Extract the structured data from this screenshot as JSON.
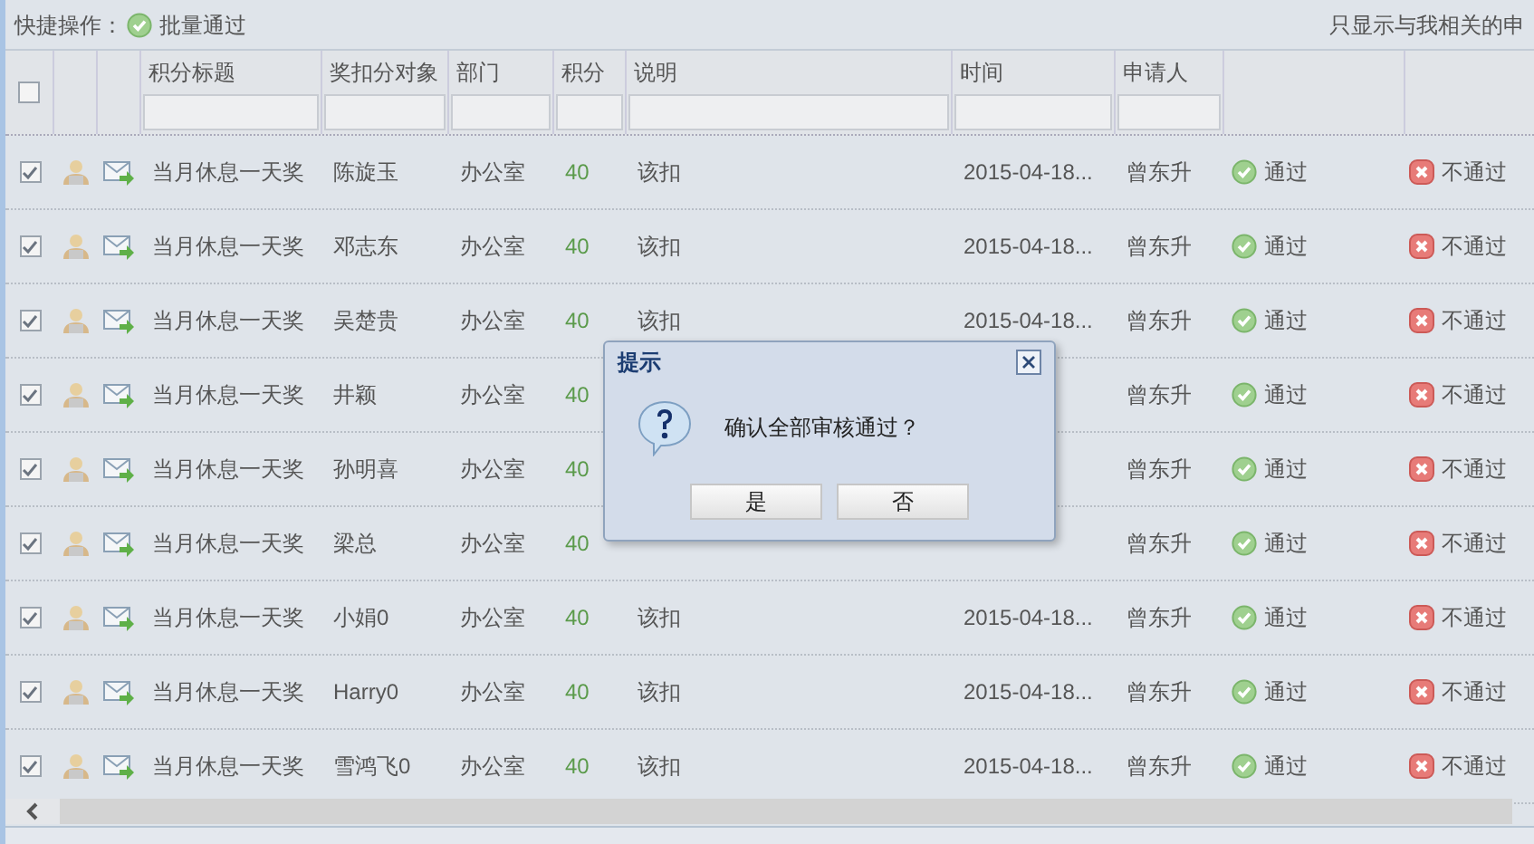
{
  "toolbar": {
    "label": "快捷操作：",
    "batch_button": "批量通过",
    "filter_text": "只显示与我相关的申"
  },
  "table": {
    "header_checked": false,
    "columns": [
      "积分标题",
      "奖扣分对象",
      "部门",
      "积分",
      "说明",
      "时间",
      "申请人"
    ],
    "rows": [
      {
        "checked": true,
        "title": "当月休息一天奖",
        "target": "陈旋玉",
        "dept": "办公室",
        "score": "40",
        "desc": "该扣",
        "time": "2015-04-18...",
        "applicant": "曾东升",
        "approve": "通过",
        "reject": "不通过"
      },
      {
        "checked": true,
        "title": "当月休息一天奖",
        "target": "邓志东",
        "dept": "办公室",
        "score": "40",
        "desc": "该扣",
        "time": "2015-04-18...",
        "applicant": "曾东升",
        "approve": "通过",
        "reject": "不通过"
      },
      {
        "checked": true,
        "title": "当月休息一天奖",
        "target": "吴楚贵",
        "dept": "办公室",
        "score": "40",
        "desc": "该扣",
        "time": "2015-04-18...",
        "applicant": "曾东升",
        "approve": "通过",
        "reject": "不通过"
      },
      {
        "checked": true,
        "title": "当月休息一天奖",
        "target": "井颖",
        "dept": "办公室",
        "score": "40",
        "applicant": "曾东升",
        "approve": "通过",
        "reject": "不通过"
      },
      {
        "checked": true,
        "title": "当月休息一天奖",
        "target": "孙明喜",
        "dept": "办公室",
        "score": "40",
        "applicant": "曾东升",
        "approve": "通过",
        "reject": "不通过"
      },
      {
        "checked": true,
        "title": "当月休息一天奖",
        "target": "梁总",
        "dept": "办公室",
        "score": "40",
        "applicant": "曾东升",
        "approve": "通过",
        "reject": "不通过"
      },
      {
        "checked": true,
        "title": "当月休息一天奖",
        "target": "小娟0",
        "dept": "办公室",
        "score": "40",
        "desc": "该扣",
        "time": "2015-04-18...",
        "applicant": "曾东升",
        "approve": "通过",
        "reject": "不通过"
      },
      {
        "checked": true,
        "title": "当月休息一天奖",
        "target": "Harry0",
        "dept": "办公室",
        "score": "40",
        "desc": "该扣",
        "time": "2015-04-18...",
        "applicant": "曾东升",
        "approve": "通过",
        "reject": "不通过"
      },
      {
        "checked": true,
        "title": "当月休息一天奖",
        "target": "雪鸿飞0",
        "dept": "办公室",
        "score": "40",
        "desc": "该扣",
        "time": "2015-04-18...",
        "applicant": "曾东升",
        "approve": "通过",
        "reject": "不通过"
      }
    ]
  },
  "dialog": {
    "title": "提示",
    "message": "确认全部审核通过？",
    "buttons": [
      "是",
      "否"
    ]
  }
}
